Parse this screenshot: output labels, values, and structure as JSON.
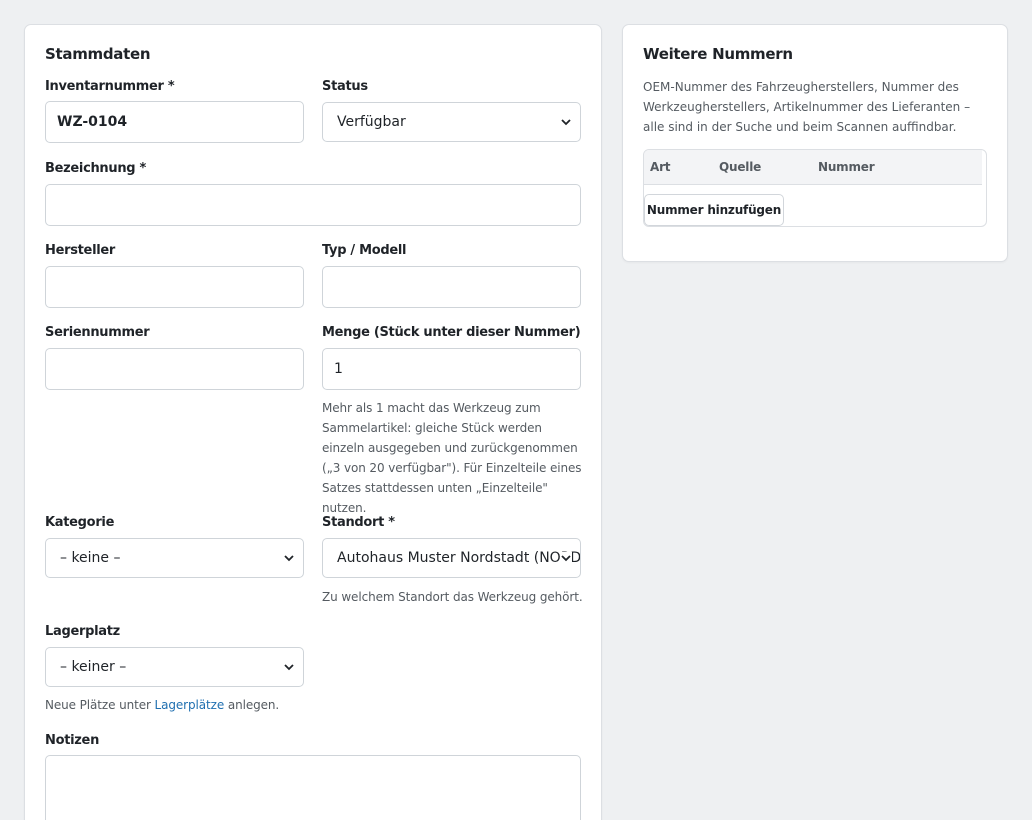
{
  "stammdaten": {
    "title": "Stammdaten",
    "inventarnummer": {
      "label": "Inventarnummer *",
      "value": "WZ-0104"
    },
    "status": {
      "label": "Status",
      "selected": "Verfügbar"
    },
    "bezeichnung": {
      "label": "Bezeichnung *",
      "value": ""
    },
    "hersteller": {
      "label": "Hersteller",
      "value": ""
    },
    "typ_modell": {
      "label": "Typ / Modell",
      "value": ""
    },
    "seriennummer": {
      "label": "Seriennummer",
      "value": ""
    },
    "menge": {
      "label": "Menge (Stück unter dieser Nummer)",
      "value": "1",
      "help": "Mehr als 1 macht das Werkzeug zum Sammelartikel: gleiche Stück werden einzeln ausgegeben und zurückgenommen („3 von 20 verfügbar\"). Für Einzelteile eines Satzes stattdessen unten „Einzelteile\" nutzen."
    },
    "kategorie": {
      "label": "Kategorie",
      "selected": "– keine –"
    },
    "standort": {
      "label": "Standort *",
      "selected": "Autohaus Muster Nordstadt (NORD)",
      "help": "Zu welchem Standort das Werkzeug gehört."
    },
    "lagerplatz": {
      "label": "Lagerplatz",
      "selected": "– keiner –",
      "help_prefix": "Neue Plätze unter ",
      "help_link": "Lagerplätze",
      "help_suffix": " anlegen."
    },
    "notizen": {
      "label": "Notizen",
      "value": ""
    }
  },
  "weitere_nummern": {
    "title": "Weitere Nummern",
    "description": "OEM-Nummer des Fahrzeugherstellers, Nummer des Werkzeugherstellers, Artikelnummer des Lieferanten – alle sind in der Suche und beim Scannen auffindbar.",
    "columns": [
      "Art",
      "Quelle",
      "Nummer"
    ],
    "add_button": "Nummer hinzufügen"
  },
  "icons": {
    "select_arrow": "chevron-down-icon"
  },
  "colors": {
    "link": "#1f6fb0",
    "page_bg": "#eef0f2"
  }
}
